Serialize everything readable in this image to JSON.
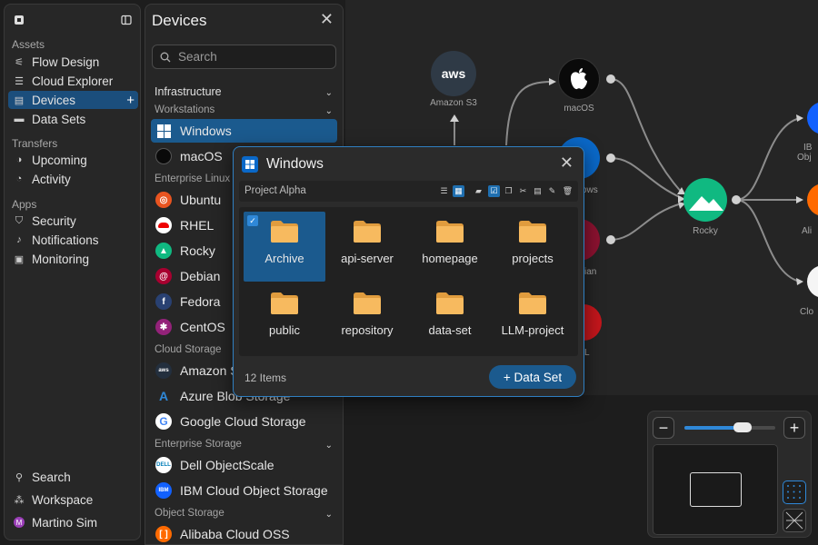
{
  "nav": {
    "sections": [
      "Assets",
      "Transfers",
      "Apps"
    ],
    "assets": [
      {
        "label": "Flow Design",
        "icon": "flow-icon"
      },
      {
        "label": "Cloud Explorer",
        "icon": "cloud-explorer-icon"
      },
      {
        "label": "Devices",
        "icon": "devices-icon",
        "active": true
      },
      {
        "label": "Data Sets",
        "icon": "datasets-icon"
      }
    ],
    "transfers": [
      {
        "label": "Upcoming",
        "icon": "upcoming-icon"
      },
      {
        "label": "Activity",
        "icon": "activity-icon"
      }
    ],
    "apps": [
      {
        "label": "Security",
        "icon": "shield-icon"
      },
      {
        "label": "Notifications",
        "icon": "bell-icon"
      },
      {
        "label": "Monitoring",
        "icon": "monitor-icon"
      }
    ],
    "bottom": {
      "search": "Search",
      "workspace": "Workspace",
      "user": "Martino Sim"
    }
  },
  "devices": {
    "title": "Devices",
    "search_placeholder": "Search",
    "group": "Infrastructure",
    "categories": {
      "workstations": "Workstations",
      "enterprise_linux": "Enterprise Linux",
      "cloud_storage": "Cloud Storage",
      "enterprise_storage": "Enterprise Storage",
      "object_storage": "Object Storage"
    },
    "items": {
      "windows": "Windows",
      "macos": "macOS",
      "ubuntu": "Ubuntu",
      "rhel": "RHEL",
      "rocky": "Rocky",
      "debian": "Debian",
      "fedora": "Fedora",
      "centos": "CentOS",
      "amazon": "Amazon S3",
      "azure": "Azure Blob Storage",
      "google": "Google Cloud Storage",
      "dell": "Dell ObjectScale",
      "ibm": "IBM Cloud Object Storage",
      "alibaba": "Alibaba Cloud OSS"
    }
  },
  "popup": {
    "title": "Windows",
    "project": "Project Alpha",
    "folders": [
      "Archive",
      "api-server",
      "homepage",
      "projects",
      "public",
      "repository",
      "data-set",
      "LLM-project"
    ],
    "count": "12 Items",
    "add_button": "+ Data Set"
  },
  "canvas": {
    "amazon_label": "Amazon S3",
    "aws_text": "aws",
    "macos_label": "macOS",
    "windows_partial": "ows",
    "debian_partial": "ian",
    "rhel_partial": "L",
    "rocky_label": "Rocky",
    "right_label_1": "IB",
    "right_label_1b": "Obj",
    "right_label_2": "Ali",
    "right_label_3": "Clo"
  },
  "colors": {
    "accent": "#1b5a8e",
    "folder": "#f2b25c",
    "rocky": "#10b981"
  }
}
